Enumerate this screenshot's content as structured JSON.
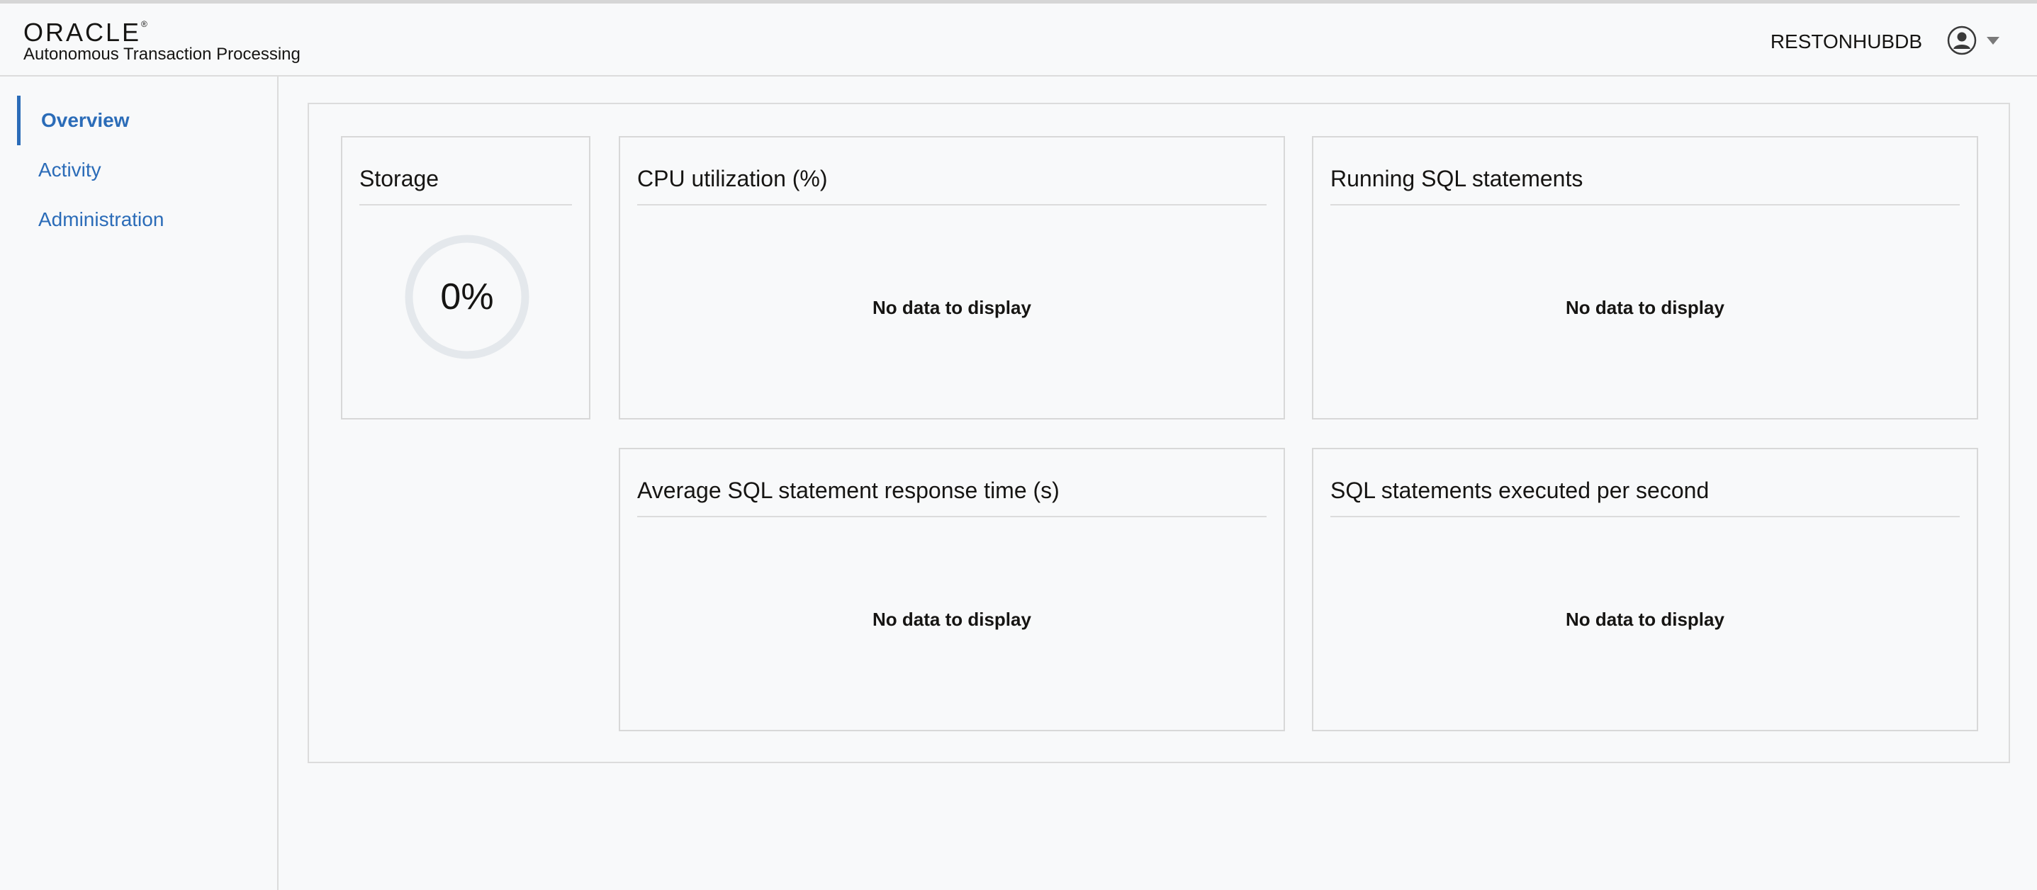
{
  "header": {
    "brand": "ORACLE",
    "product": "Autonomous Transaction Processing",
    "database_name": "RESTONHUBDB",
    "user_icon": "user-avatar-icon",
    "menu_icon": "caret-down-icon"
  },
  "sidebar": {
    "items": [
      {
        "label": "Overview",
        "active": true
      },
      {
        "label": "Activity",
        "active": false
      },
      {
        "label": "Administration",
        "active": false
      }
    ]
  },
  "main": {
    "storage": {
      "title": "Storage",
      "value": "0%",
      "level": 0
    },
    "cpu": {
      "title": "CPU utilization (%)",
      "empty_text": "No data to display"
    },
    "running_sql": {
      "title": "Running SQL statements",
      "empty_text": "No data to display"
    },
    "avg_response": {
      "title": "Average SQL statement response time (s)",
      "empty_text": "No data to display"
    },
    "sql_per_second": {
      "title": "SQL statements executed per second",
      "empty_text": "No data to display"
    }
  },
  "colors": {
    "accent": "#2b6cb8",
    "gauge_track": "#e4e8ec"
  }
}
